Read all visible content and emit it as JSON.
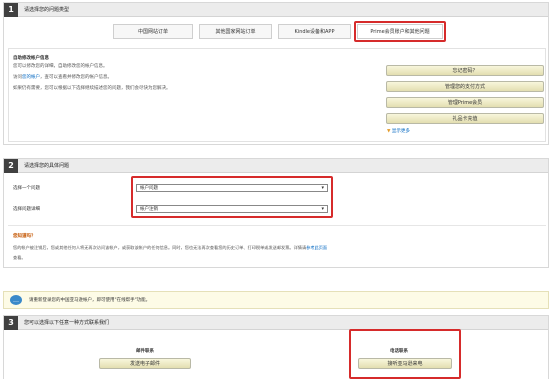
{
  "section1": {
    "num": "1",
    "title": "请选择您的问题类型",
    "tabs": [
      "中国网站订单",
      "其他国家网站订单",
      "Kindle设备和APP",
      "Prime会员账户和其他问题"
    ],
    "panel_title": "自助修改帐户信息",
    "line1": "您可以修改您的详细，自助修改您的帐户信息。",
    "line2_pre": "访问",
    "line2_link": "您的帐户",
    "line2_post": "，查可以查看并修改您的帐户信息。",
    "line3": "如果仍有需要，您可以根据以下选择继续描述您的问题，我们会尽快为您解决。",
    "side_buttons": [
      "忘记密码？",
      "管理您的支付方式",
      "管理Prime会员",
      "礼品卡充值"
    ],
    "show_more": "显示更多"
  },
  "section2": {
    "num": "2",
    "title": "请选择您的具体问题",
    "field1_label": "选择一个问题",
    "field1_value": "帐户问题",
    "field2_label": "选择问题详细",
    "field2_value": "帐户注销",
    "notice_title": "您知道吗？",
    "notice_line1": "您的帐户被注销后，您或其他任何人将无再次访问该帐户，或获取该帐户的任何信息。同时，您也无法再次查看您的历史订单、打印税单或发送邮发票。详情请",
    "notice_link": "参考此页面",
    "notice_line2": "查看。"
  },
  "tip": {
    "text": "请重新登录您的中国亚马逊帐户，即可使用\"在线帮手\"功能。"
  },
  "section3": {
    "num": "3",
    "title": "您可以选择以下任意一种方式联系我们",
    "email_title": "邮件联系",
    "email_button": "发送电子邮件",
    "phone_title": "电话联系",
    "phone_button": "接听亚马逊来电"
  },
  "colors": {
    "highlight": "#d62b2b",
    "link": "#0066c0",
    "button_top": "#f8f6dc",
    "button_bottom": "#e3deb1"
  }
}
